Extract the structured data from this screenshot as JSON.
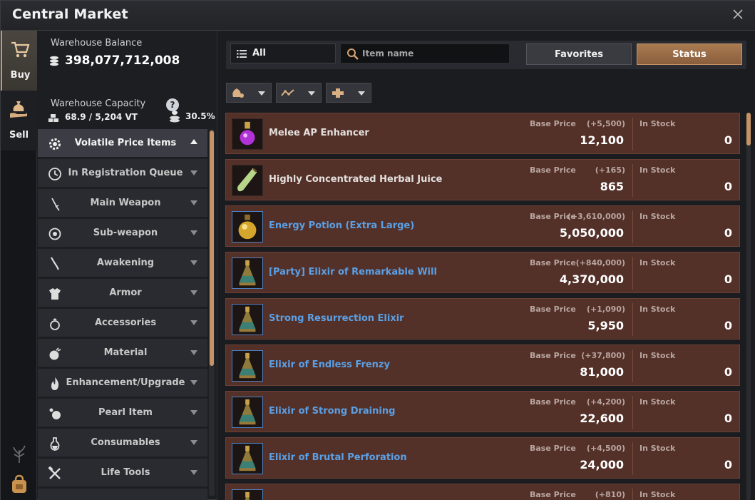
{
  "window": {
    "title": "Central Market"
  },
  "tabs": [
    {
      "label": "Buy",
      "icon": "cart-icon",
      "active": true
    },
    {
      "label": "Sell",
      "icon": "money-bag-hand-icon",
      "active": false
    }
  ],
  "warehouse": {
    "balance_label": "Warehouse Balance",
    "balance_value": "398,077,712,008",
    "capacity_label": "Warehouse Capacity",
    "help_symbol": "?",
    "weight_value": "68.9 / 5,204 VT",
    "capacity_percent": "30.5%"
  },
  "categories": [
    {
      "label": "Volatile Price Items",
      "icon": "gear-icon",
      "active": true
    },
    {
      "label": "In Registration Queue",
      "icon": "clock-icon"
    },
    {
      "label": "Main Weapon",
      "icon": "sword-icon"
    },
    {
      "label": "Sub-weapon",
      "icon": "shield-icon"
    },
    {
      "label": "Awakening",
      "icon": "blade-icon"
    },
    {
      "label": "Armor",
      "icon": "armor-icon"
    },
    {
      "label": "Accessories",
      "icon": "ring-icon"
    },
    {
      "label": "Material",
      "icon": "ore-icon"
    },
    {
      "label": "Enhancement/Upgrade",
      "icon": "flame-icon"
    },
    {
      "label": "Pearl Item",
      "icon": "pearl-icon"
    },
    {
      "label": "Consumables",
      "icon": "potion-icon"
    },
    {
      "label": "Life Tools",
      "icon": "hammer-icon"
    }
  ],
  "toolbar": {
    "filter_label": "All",
    "search_placeholder": "Item name",
    "favorites_label": "Favorites",
    "status_label": "Status"
  },
  "sort_buttons": [
    "bag-sort-icon",
    "trend-sort-icon",
    "plus-sort-icon"
  ],
  "columns": {
    "base_price": "Base Price",
    "in_stock": "In Stock"
  },
  "items": [
    {
      "name": "Melee AP Enhancer",
      "delta": "(+5,500)",
      "price": "12,100",
      "stock": "0",
      "highlight": false,
      "icon": "purple-potion-icon"
    },
    {
      "name": "Highly Concentrated Herbal Juice",
      "delta": "(+165)",
      "price": "865",
      "stock": "0",
      "highlight": false,
      "icon": "green-vial-icon"
    },
    {
      "name": "Energy Potion (Extra Large)",
      "delta": "(+3,610,000)",
      "price": "5,050,000",
      "stock": "0",
      "highlight": true,
      "icon": "gold-potion-icon"
    },
    {
      "name": "[Party] Elixir of Remarkable Will",
      "delta": "(+840,000)",
      "price": "4,370,000",
      "stock": "0",
      "highlight": true,
      "icon": "elixir-icon"
    },
    {
      "name": "Strong Resurrection Elixir",
      "delta": "(+1,090)",
      "price": "5,950",
      "stock": "0",
      "highlight": true,
      "icon": "elixir-icon"
    },
    {
      "name": "Elixir of Endless Frenzy",
      "delta": "(+37,800)",
      "price": "81,000",
      "stock": "0",
      "highlight": true,
      "icon": "elixir-icon"
    },
    {
      "name": "Elixir of Strong Draining",
      "delta": "(+4,200)",
      "price": "22,600",
      "stock": "0",
      "highlight": true,
      "icon": "elixir-icon"
    },
    {
      "name": "Elixir of Brutal Perforation",
      "delta": "(+4,500)",
      "price": "24,000",
      "stock": "0",
      "highlight": true,
      "icon": "elixir-icon"
    },
    {
      "name": "",
      "delta": "(+810)",
      "price": "",
      "stock": "",
      "highlight": true,
      "icon": "elixir-icon"
    }
  ],
  "colors": {
    "accent": "#c49467",
    "item_bg": "#533028",
    "link_blue": "#5aa0e6"
  }
}
